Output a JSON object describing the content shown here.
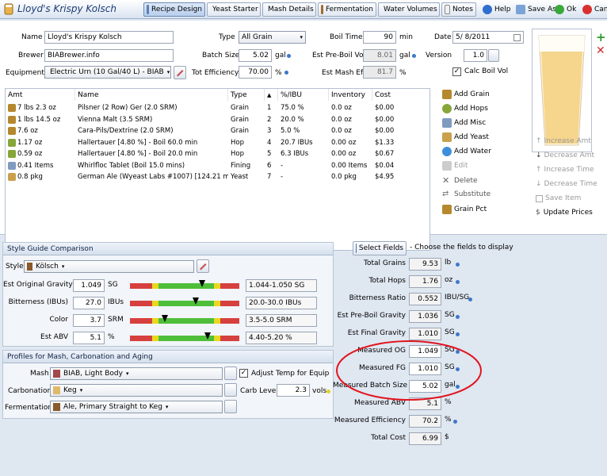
{
  "app": {
    "title": "Lloyd's Krispy Kolsch"
  },
  "toolbar": {
    "tabs": [
      "Recipe Design",
      "Yeast Starter",
      "Mash Details",
      "Fermentation",
      "Water Volumes",
      "Notes"
    ],
    "help": "Help",
    "save_as": "Save As",
    "ok": "Ok",
    "cancel": "Canc"
  },
  "recipe": {
    "name_label": "Name",
    "name": "Lloyd's Krispy Kolsch",
    "brewer_label": "Brewer",
    "brewer": "BIABrewer.info",
    "equipment_label": "Equipment",
    "equipment": "Electric Urn (10 Gal/40 L) - BIAB",
    "type_label": "Type",
    "type": "All Grain",
    "batch_label": "Batch Size",
    "batch_size": "5.02",
    "batch_unit": "gal",
    "efficiency_label": "Tot Efficiency",
    "efficiency": "70.00",
    "efficiency_unit": "%",
    "boil_time_label": "Boil Time",
    "boil_time": "90",
    "boil_time_unit": "min",
    "preboil_label": "Est Pre-Boil Vol",
    "preboil": "8.01",
    "preboil_unit": "gal",
    "mash_eff_label": "Est Mash Eff",
    "mash_eff": "81.7",
    "mash_eff_unit": "%",
    "date_label": "Date",
    "date": "5/ 8/2011",
    "version_label": "Version",
    "version": "1.0",
    "calc_boil_label": "Calc Boil Vol"
  },
  "ingredients": {
    "columns": [
      "Amt",
      "Name",
      "Type",
      "#",
      "%/IBU",
      "Inventory",
      "Cost"
    ],
    "rows": [
      {
        "amt": "7 lbs 2.3 oz",
        "name": "Pilsner (2 Row) Ger (2.0 SRM)",
        "type": "Grain",
        "num": "1",
        "pct": "75.0 %",
        "inv": "0.0 oz",
        "cost": "$0.00",
        "icon": "grain"
      },
      {
        "amt": "1 lbs 14.5 oz",
        "name": "Vienna Malt (3.5 SRM)",
        "type": "Grain",
        "num": "2",
        "pct": "20.0 %",
        "inv": "0.0 oz",
        "cost": "$0.00",
        "icon": "grain"
      },
      {
        "amt": "7.6 oz",
        "name": "Cara-Pils/Dextrine (2.0 SRM)",
        "type": "Grain",
        "num": "3",
        "pct": "5.0 %",
        "inv": "0.0 oz",
        "cost": "$0.00",
        "icon": "grain"
      },
      {
        "amt": "1.17 oz",
        "name": "Hallertauer [4.80 %] - Boil 60.0 min",
        "type": "Hop",
        "num": "4",
        "pct": "20.7 IBUs",
        "inv": "0.00 oz",
        "cost": "$1.33",
        "icon": "hop"
      },
      {
        "amt": "0.59 oz",
        "name": "Hallertauer [4.80 %] - Boil 20.0 min",
        "type": "Hop",
        "num": "5",
        "pct": "6.3 IBUs",
        "inv": "0.00 oz",
        "cost": "$0.67",
        "icon": "hop"
      },
      {
        "amt": "0.41 Items",
        "name": "Whirlfloc Tablet (Boil 15.0 mins)",
        "type": "Fining",
        "num": "6",
        "pct": "-",
        "inv": "0.00 Items",
        "cost": "$0.04",
        "icon": "misc"
      },
      {
        "amt": "0.8 pkg",
        "name": "German Ale (Wyeast Labs #1007) [124.21 ml]",
        "type": "Yeast",
        "num": "7",
        "pct": "-",
        "inv": "0.0 pkg",
        "cost": "$4.95",
        "icon": "yeast"
      }
    ]
  },
  "actions": {
    "add_grain": "Add Grain",
    "add_hops": "Add Hops",
    "add_misc": "Add Misc",
    "add_yeast": "Add Yeast",
    "add_water": "Add Water",
    "edit": "Edit",
    "delete": "Delete",
    "substitute": "Substitute",
    "grain_pct": "Grain Pct",
    "increase_amt": "Increase Amt",
    "decrease_amt": "Decrease Amt",
    "increase_time": "Increase Time",
    "decrease_time": "Decrease Time",
    "save_item": "Save Item",
    "update_prices": "Update Prices"
  },
  "style_guide": {
    "header": "Style Guide Comparison",
    "style_label": "Style",
    "style": "Kölsch",
    "rows": [
      {
        "label": "Est Original Gravity",
        "value": "1.049",
        "unit": "SG",
        "range": "1.044-1.050 SG",
        "marker": 0.66
      },
      {
        "label": "Bitterness (IBUs)",
        "value": "27.0",
        "unit": "IBUs",
        "range": "20.0-30.0 IBUs",
        "marker": 0.6
      },
      {
        "label": "Color",
        "value": "3.7",
        "unit": "SRM",
        "range": "3.5-5.0 SRM",
        "marker": 0.32
      },
      {
        "label": "Est ABV",
        "value": "5.1",
        "unit": "%",
        "range": "4.40-5.20 %",
        "marker": 0.71
      }
    ]
  },
  "profiles": {
    "header": "Profiles for Mash, Carbonation and Aging",
    "mash_label": "Mash",
    "mash": "BIAB, Light Body",
    "adjust_temp_label": "Adjust Temp for Equip",
    "carb_label": "Carbonation",
    "carb": "Keg",
    "carb_level_label": "Carb Level",
    "carb_level": "2.3",
    "carb_level_unit": "vols",
    "ferm_label": "Fermentation",
    "ferm": "Ale, Primary Straight to Keg"
  },
  "select_fields": {
    "button": "Select Fields",
    "hint": "- Choose the fields to display"
  },
  "stats": [
    {
      "label": "Total Grains",
      "value": "9.53",
      "unit": "lb"
    },
    {
      "label": "Total Hops",
      "value": "1.76",
      "unit": "oz"
    },
    {
      "label": "Bitterness Ratio",
      "value": "0.552",
      "unit": "IBU/SG"
    },
    {
      "label": "Est Pre-Boil Gravity",
      "value": "1.036",
      "unit": "SG"
    },
    {
      "label": "Est Final Gravity",
      "value": "1.010",
      "unit": "SG"
    },
    {
      "label": "Measured OG",
      "value": "1.049",
      "unit": "SG"
    },
    {
      "label": "Measured FG",
      "value": "1.010",
      "unit": "SG"
    },
    {
      "label": "Measured Batch Size",
      "value": "5.02",
      "unit": "gal"
    },
    {
      "label": "Measured ABV",
      "value": "5.1",
      "unit": "%"
    },
    {
      "label": "Measured Efficiency",
      "value": "70.2",
      "unit": "%"
    },
    {
      "label": "Total Cost",
      "value": "6.99",
      "unit": "$"
    }
  ],
  "colors": {
    "accent": "#3d78c9",
    "annotation": "#e0141e",
    "beer": "#f6d58c"
  }
}
